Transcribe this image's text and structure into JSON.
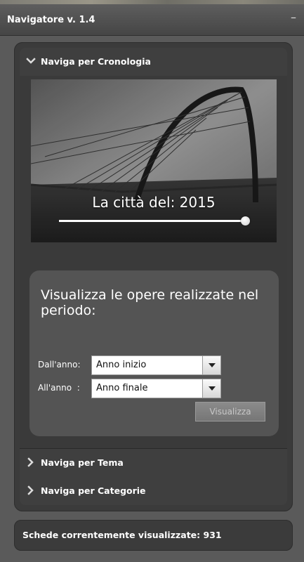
{
  "window": {
    "title": "Navigatore v. 1.4",
    "minimize_label": "–"
  },
  "accordion": {
    "cronologia": {
      "label": "Naviga per Cronologia",
      "expanded": true
    },
    "tema": {
      "label": "Naviga per Tema",
      "expanded": false
    },
    "categorie": {
      "label": "Naviga per Categorie",
      "expanded": false
    }
  },
  "timeline": {
    "caption": "La città del: 2015",
    "year_value": 1.0
  },
  "period": {
    "title": "Visualizza le opere realizzate nel periodo:",
    "from_label": "Dall'anno:",
    "from_value": "Anno inizio",
    "to_label": "All'anno  :",
    "to_value": "Anno finale",
    "submit_label": "Visualizza"
  },
  "status": {
    "text": "Schede correntemente visualizzate: 931"
  },
  "colors": {
    "panel": "#3b3b3b",
    "background": "#5a5a5a",
    "box": "#545454"
  }
}
